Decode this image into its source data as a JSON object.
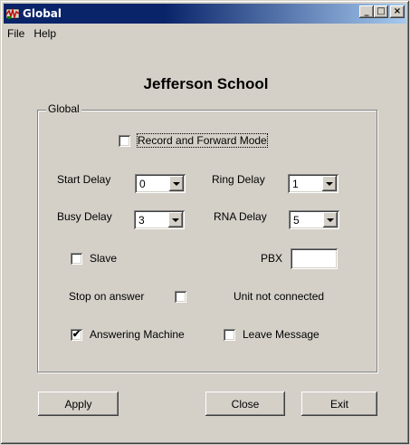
{
  "window": {
    "title": "Global",
    "minimize_glyph": "_",
    "maximize_glyph": "□",
    "close_glyph": "×"
  },
  "menu": {
    "items": [
      {
        "label": "File"
      },
      {
        "label": "Help"
      }
    ]
  },
  "school_name": "Jefferson School",
  "group": {
    "label": "Global",
    "record_forward": {
      "label": "Record and Forward Mode",
      "checked": false
    },
    "start_delay": {
      "label": "Start Delay",
      "value": "0"
    },
    "ring_delay": {
      "label": "Ring Delay",
      "value": "1"
    },
    "busy_delay": {
      "label": "Busy Delay",
      "value": "3"
    },
    "rna_delay": {
      "label": "RNA Delay",
      "value": "5"
    },
    "slave": {
      "label": "Slave",
      "checked": false
    },
    "pbx": {
      "label": "PBX",
      "value": ""
    },
    "stop_on_answer": {
      "label": "Stop on answer",
      "checked": false
    },
    "unit_status": "Unit not connected",
    "answering_machine": {
      "label": "Answering Machine",
      "checked": true,
      "check_glyph": "✔"
    },
    "leave_message": {
      "label": "Leave Message",
      "checked": false
    }
  },
  "buttons": {
    "apply": "Apply",
    "close": "Close",
    "exit": "Exit"
  },
  "colors": {
    "face": "#d4d0c8",
    "titlebar_start": "#0a246a",
    "titlebar_end": "#a6caf0"
  }
}
